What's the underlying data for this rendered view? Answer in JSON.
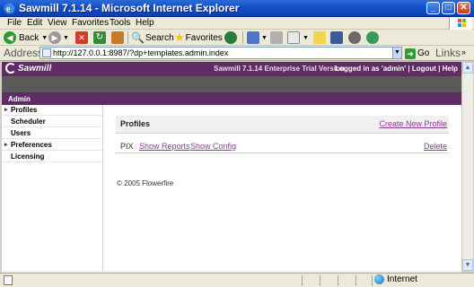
{
  "window": {
    "title": "Sawmill 7.1.14 - Microsoft Internet Explorer",
    "controls": {
      "minimize": "_",
      "maximize": "□",
      "close": "✕"
    }
  },
  "menu": [
    "File",
    "Edit",
    "View",
    "Favorites",
    "Tools",
    "Help"
  ],
  "toolbar": {
    "back": "Back",
    "search": "Search",
    "favorites": "Favorites"
  },
  "address": {
    "label": "Address",
    "url": "http://127.0.0.1:8987/?dp+templates.admin.index",
    "go": "Go",
    "links": "Links"
  },
  "app": {
    "logo": "Sawmill",
    "version": "Sawmill 7.1.14 Enterprise Trial Version",
    "login_text": "Logged in as 'admin' | Logout | Help",
    "tab": "Admin"
  },
  "sidebar": {
    "items": [
      {
        "label": "Profiles",
        "bullet": "▸"
      },
      {
        "label": "Scheduler",
        "bullet": ""
      },
      {
        "label": "Users",
        "bullet": ""
      },
      {
        "label": "Preferences",
        "bullet": "▸"
      },
      {
        "label": "Licensing",
        "bullet": ""
      }
    ]
  },
  "main": {
    "title": "Profiles",
    "create_link": "Create New Profile",
    "profiles": [
      {
        "name": "PIX",
        "show_reports": "Show Reports",
        "show_config": "Show Config",
        "delete": "Delete"
      }
    ],
    "copyright": "© 2005 Flowerfire"
  },
  "status": {
    "zone": "Internet"
  },
  "colors": {
    "xp_title": "#0b3fae",
    "app_header": "#5f2c64",
    "link": "#8e3a96"
  }
}
